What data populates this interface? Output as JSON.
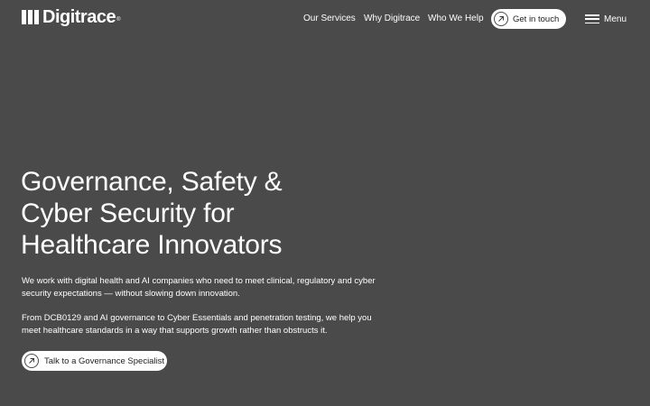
{
  "header": {
    "logo": {
      "text": "Digitrace",
      "registered": "®"
    },
    "nav": {
      "items": [
        {
          "label": "Our Services"
        },
        {
          "label": "Why Digitrace"
        },
        {
          "label": "Who We Help"
        }
      ]
    },
    "cta": {
      "label": "Get in touch",
      "icon": "arrow-up-right-icon"
    },
    "menu": {
      "label": "Menu",
      "icon": "hamburger-icon"
    }
  },
  "hero": {
    "title_lines": [
      "Governance, Safety &",
      "Cyber Security for",
      "Healthcare Innovators"
    ],
    "paragraphs": [
      "We work with digital health and AI companies who need to meet clinical, regulatory and cyber security expectations — without slowing down innovation.",
      "From DCB0129 and AI governance to Cyber Essentials and penetration testing, we help you meet healthcare standards in a way that supports growth rather than obstructs it."
    ],
    "cta": {
      "label": "Talk to a Governance Specialist",
      "icon": "arrow-up-right-icon"
    }
  },
  "colors": {
    "background": "#4a4a4a",
    "text": "#ffffff",
    "button_background": "#ffffff",
    "button_text": "#222222"
  }
}
